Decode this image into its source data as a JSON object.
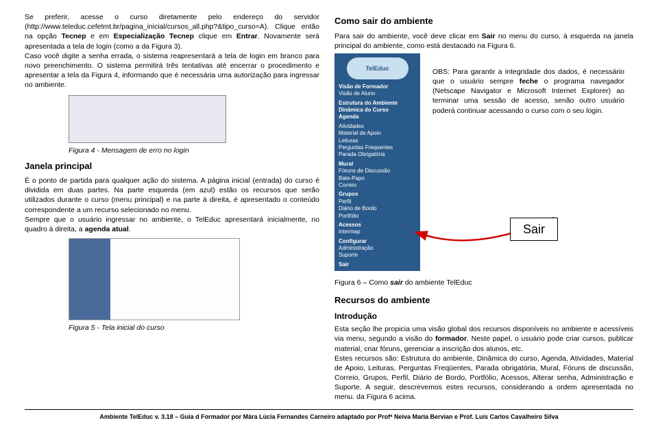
{
  "leftCol": {
    "para1_a": "Se preferir, acesse o curso diretamente pelo endereço do servidor (http://www.teleduc.cefetmt.br/pagina_inicial/cursos_all.php?&tipo_curso=A). Clique então na opção ",
    "para1_b1": "Tecnep",
    "para1_c": " e em ",
    "para1_b2": "Especialização Tecnep",
    "para1_d": " clique em ",
    "para1_b3": "Entrar",
    "para1_e": ". Novamente será apresentada a tela de login (como a da Figura 3).",
    "para2": "Caso você digite a senha errada, o sistema reapresentará a tela de login em branco para novo preenchimento. O sistema permitirá três tentativas até encerrar o procedimento e apresentar a tela da Figura 4, informando que é necessária uma autorização para ingressar no ambiente.",
    "fig4Cap": "Figura 4 - Mensagem de erro no login",
    "janelaTitle": "Janela principal",
    "para3": "É o ponto de partida para qualquer ação do sistema. A página inicial (entrada) do curso é dividida em duas partes. Na parte esquerda (em azul) estão os recursos que serão utilizados durante o curso (menu principal) e na parte à direita, é apresentado o conteúdo correspondente a um recurso selecionado no menu.",
    "para4_a": "Sempre que o usuário ingressar no ambiente, o TelEduc apresentará inicialmente, no quadro à direita, a ",
    "para4_b": "agenda atual",
    "para4_c": ".",
    "fig5Cap": "Figura 5 - Tela inicial do curso"
  },
  "rightCol": {
    "comoSairTitle": "Como sair do ambiente",
    "comoSairP_a": "Para sair do ambiente, você deve clicar em ",
    "comoSairP_b": "Sair",
    "comoSairP_c": " no menu do curso, à esquerda na janela principal do ambiente, como está destacado na Figura 6.",
    "menu": {
      "logo": "TelEduc",
      "items": [
        {
          "t": "Visão de Formador",
          "b": true
        },
        {
          "t": "Visão de Aluno",
          "b": false
        },
        {
          "t": "Estrutura do Ambiente",
          "b": true,
          "g": true
        },
        {
          "t": "Dinâmica do Curso",
          "b": true
        },
        {
          "t": "Agenda",
          "b": true
        },
        {
          "t": "Atividades",
          "b": false,
          "g": true
        },
        {
          "t": "Material de Apoio",
          "b": false
        },
        {
          "t": "Leituras",
          "b": false
        },
        {
          "t": "Perguntas Frequentes",
          "b": false
        },
        {
          "t": "Parada Obrigatória",
          "b": false
        },
        {
          "t": "Mural",
          "b": true,
          "g": true
        },
        {
          "t": "Fóruns de Discussão",
          "b": false
        },
        {
          "t": "Bate-Papo",
          "b": false
        },
        {
          "t": "Correio",
          "b": false
        },
        {
          "t": "Grupos",
          "b": true,
          "g": true
        },
        {
          "t": "Perfil",
          "b": false
        },
        {
          "t": "Diário de Bordo",
          "b": false
        },
        {
          "t": "Portfólio",
          "b": false
        },
        {
          "t": "Acessos",
          "b": true,
          "g": true
        },
        {
          "t": "Intermap",
          "b": false
        },
        {
          "t": "Configurar",
          "b": true,
          "g": true
        },
        {
          "t": "Administração",
          "b": false
        },
        {
          "t": "Suporte",
          "b": false
        },
        {
          "t": "Sair",
          "b": true,
          "g": true
        }
      ]
    },
    "obs_a": "OBS: Para garantir a integridade dos dados, é necessário que o usuário sempre ",
    "obs_b": "feche",
    "obs_c": " o programa navegador (Netscape Navigator e Microsoft Internet Explorer) ao terminar uma sessão de acesso, senão outro usuário poderá continuar acessando o curso com o seu login.",
    "sairBox": "Sair",
    "fig6_a": "Figura 6 – Como ",
    "fig6_b": "sair",
    "fig6_c": " do ambiente TelEduc",
    "recursosTitle": "Recursos do ambiente",
    "introTitle": "Introdução",
    "introP1_a": "Esta seção lhe propicia uma visão global dos recursos disponíveis no ambiente e acessíveis via menu, segundo a visão do ",
    "introP1_b": "formador",
    "introP1_c": ". Neste papel, o usuário pode criar cursos, publicar material, criar fóruns, gerenciar a inscrição dos alunos, etc.",
    "introP2": "Estes recursos são: Estrutura do ambiente, Dinâmica do curso, Agenda, Atividades, Material de Apoio, Leituras, Perguntas Freqüentes, Parada obrigatória, Mural, Fóruns de discussão, Correio, Grupos, Perfil, Diário de Bordo, Portfólio, Acessos, Alterar senha, Administração e Suporte. A seguir, descrevemos estes recursos, considerando a ordem apresentada no menu. da Figura 6 acima."
  },
  "footer": "Ambiente TelEduc v. 3.18 – Guia d Formador por Mára Lúcia Fernandes Carneiro adaptado por Profª Neiva Maria Bervian e Prof. Luís Carlos Cavalheiro Silva"
}
